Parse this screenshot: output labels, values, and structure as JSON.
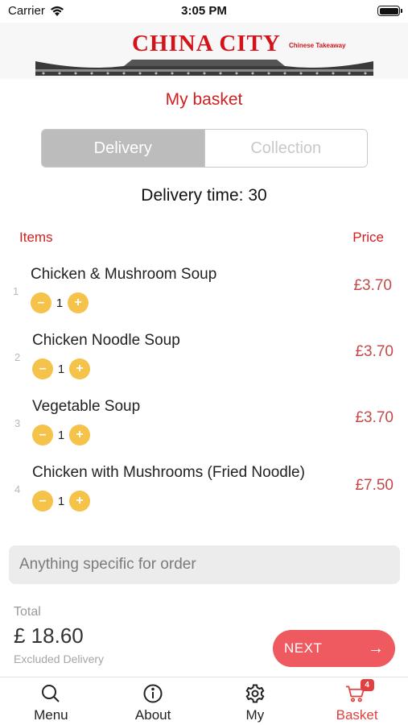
{
  "status_bar": {
    "carrier": "Carrier",
    "time": "3:05 PM"
  },
  "header": {
    "logo_title": "CHINA CITY",
    "logo_subtitle": "Chinese Takeaway"
  },
  "page_title": "My basket",
  "order_type": {
    "options": [
      "Delivery",
      "Collection"
    ],
    "selected": "Delivery"
  },
  "delivery_time": "Delivery time: 30",
  "columns": {
    "items": "Items",
    "price": "Price"
  },
  "items": [
    {
      "index": "1",
      "name": "Chicken & Mushroom Soup",
      "qty": "1",
      "price": "£3.70",
      "minus": "–",
      "plus": "+"
    },
    {
      "index": "2",
      "name": "Chicken Noodle Soup",
      "qty": "1",
      "price": "£3.70",
      "minus": "–",
      "plus": "+"
    },
    {
      "index": "3",
      "name": "Vegetable Soup",
      "qty": "1",
      "price": "£3.70",
      "minus": "–",
      "plus": "+"
    },
    {
      "index": "4",
      "name": "Chicken with Mushrooms (Fried Noodle)",
      "qty": "1",
      "price": "£7.50",
      "minus": "–",
      "plus": "+"
    }
  ],
  "note": {
    "placeholder": "Anything specific for order",
    "value": ""
  },
  "total": {
    "label": "Total",
    "amount": "£ 18.60",
    "note": "Excluded Delivery"
  },
  "next_button": {
    "label": "NEXT"
  },
  "tabs": [
    {
      "label": "Menu",
      "icon": "search-icon"
    },
    {
      "label": "About",
      "icon": "info-icon"
    },
    {
      "label": "My",
      "icon": "gear-icon"
    },
    {
      "label": "Basket",
      "icon": "cart-icon",
      "badge": "4",
      "active": true
    }
  ],
  "colors": {
    "accent": "#d0201f",
    "quantity_button": "#f5c24a",
    "next_button": "#ee5a5f",
    "active_tab": "#e0403f"
  }
}
